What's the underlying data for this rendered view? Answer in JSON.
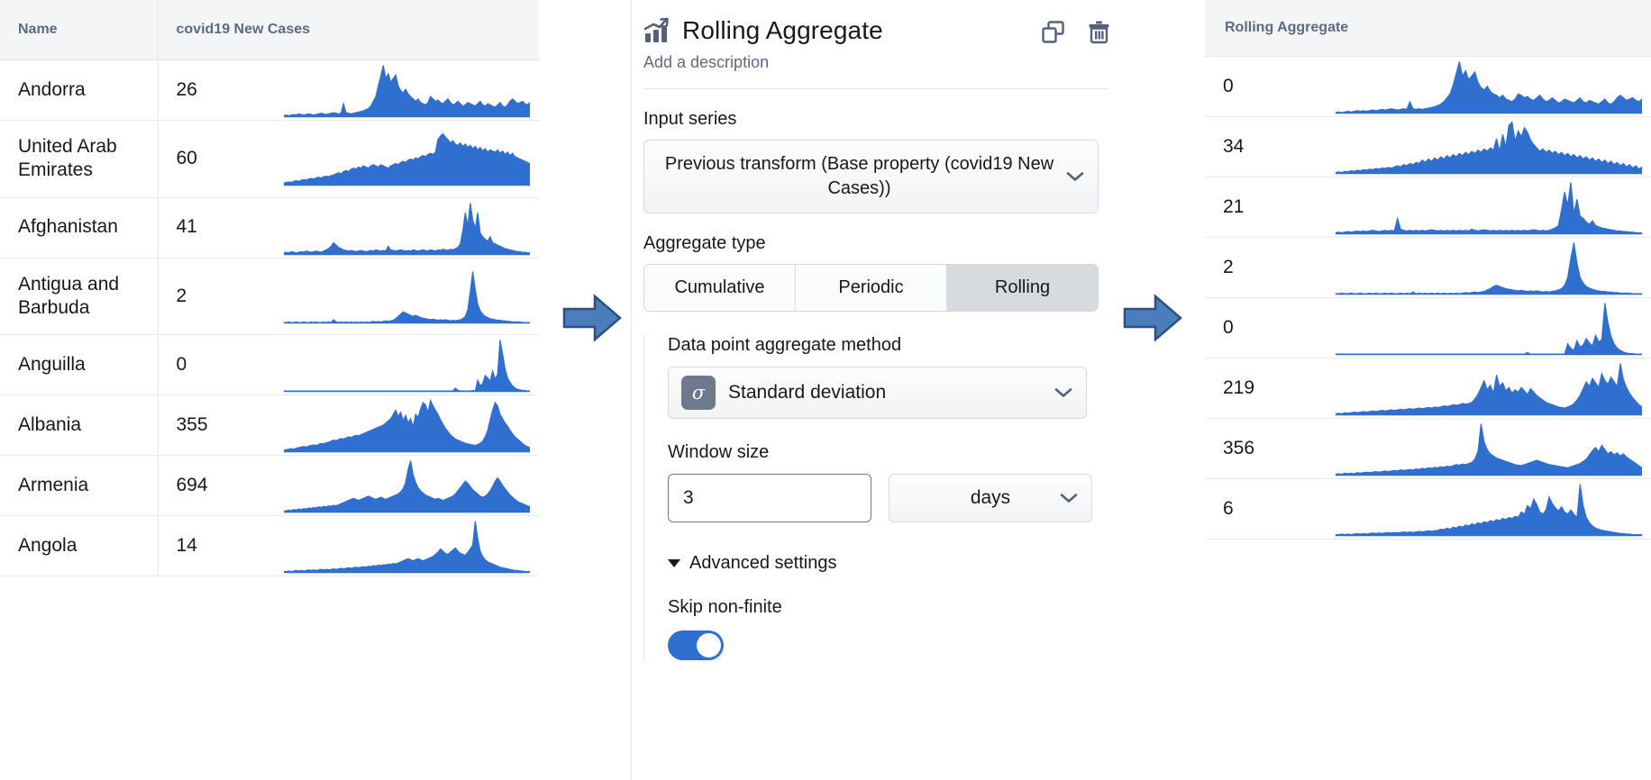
{
  "left_table": {
    "columns": [
      "Name",
      "covid19 New Cases",
      ""
    ],
    "rows": [
      {
        "name": "Andorra",
        "value": "26",
        "spark": "andorra-sparkline"
      },
      {
        "name": "United Arab Emirates",
        "value": "60",
        "spark": "uae-sparkline"
      },
      {
        "name": "Afghanistan",
        "value": "41",
        "spark": "afghanistan-sparkline"
      },
      {
        "name": "Antigua and Barbuda",
        "value": "2",
        "spark": "antigua-sparkline"
      },
      {
        "name": "Anguilla",
        "value": "0",
        "spark": "anguilla-sparkline"
      },
      {
        "name": "Albania",
        "value": "355",
        "spark": "albania-sparkline"
      },
      {
        "name": "Armenia",
        "value": "694",
        "spark": "armenia-sparkline"
      },
      {
        "name": "Angola",
        "value": "14",
        "spark": "angola-sparkline"
      }
    ]
  },
  "right_table": {
    "column": "Rolling Aggregate",
    "rows": [
      {
        "value": "0",
        "spark": "result-sparkline-1"
      },
      {
        "value": "34",
        "spark": "result-sparkline-2"
      },
      {
        "value": "21",
        "spark": "result-sparkline-3"
      },
      {
        "value": "2",
        "spark": "result-sparkline-4"
      },
      {
        "value": "0",
        "spark": "result-sparkline-5"
      },
      {
        "value": "219",
        "spark": "result-sparkline-6"
      },
      {
        "value": "356",
        "spark": "result-sparkline-7"
      },
      {
        "value": "6",
        "spark": "result-sparkline-8"
      }
    ]
  },
  "panel": {
    "icon": "chart-trending-up-icon",
    "title": "Rolling Aggregate",
    "description_placeholder": "Add a description",
    "actions": {
      "duplicate": "duplicate-icon",
      "delete": "trash-icon"
    },
    "input_series": {
      "label": "Input series",
      "value": "Previous transform (Base property (covid19 New Cases))"
    },
    "aggregate_type": {
      "label": "Aggregate type",
      "options": [
        "Cumulative",
        "Periodic",
        "Rolling"
      ],
      "selected": "Rolling"
    },
    "aggregate_method": {
      "label": "Data point aggregate method",
      "badge": "σ",
      "value": "Standard deviation"
    },
    "window_size": {
      "label": "Window size",
      "value": "3",
      "unit": "days"
    },
    "advanced": {
      "label": "Advanced settings",
      "expanded": true,
      "skip_non_finite_label": "Skip non-finite",
      "skip_non_finite_on": true
    }
  },
  "colors": {
    "sparkline": "#2f6fd0",
    "accent": "#2f6fd0",
    "arrow_fill": "#4a7ebb",
    "arrow_stroke": "#2d4f85",
    "header_bg": "#f4f5f7",
    "header_text": "#5d6b82",
    "icon": "#55617a"
  },
  "sparklines": {
    "andorra-sparkline": [
      2,
      3,
      2,
      3,
      4,
      3,
      5,
      4,
      3,
      4,
      5,
      4,
      3,
      4,
      5,
      6,
      5,
      4,
      5,
      6,
      7,
      6,
      5,
      6,
      22,
      7,
      6,
      5,
      6,
      7,
      8,
      9,
      10,
      12,
      14,
      18,
      26,
      34,
      52,
      68,
      86,
      64,
      72,
      58,
      64,
      70,
      52,
      44,
      40,
      46,
      38,
      34,
      30,
      26,
      30,
      24,
      22,
      20,
      24,
      34,
      30,
      26,
      28,
      24,
      22,
      26,
      30,
      24,
      20,
      22,
      26,
      22,
      18,
      20,
      24,
      22,
      20,
      18,
      22,
      26,
      20,
      18,
      22,
      20,
      18,
      16,
      20,
      24,
      18,
      16,
      20,
      26,
      30,
      26,
      22,
      24,
      26,
      22,
      20,
      24
    ],
    "uae-sparkline": [
      4,
      5,
      6,
      5,
      7,
      8,
      7,
      9,
      10,
      9,
      11,
      12,
      11,
      13,
      14,
      13,
      15,
      16,
      15,
      17,
      18,
      20,
      22,
      20,
      24,
      26,
      24,
      28,
      30,
      28,
      32,
      30,
      34,
      32,
      30,
      34,
      36,
      34,
      32,
      36,
      34,
      32,
      30,
      34,
      36,
      38,
      36,
      40,
      42,
      40,
      44,
      46,
      44,
      48,
      46,
      50,
      52,
      50,
      54,
      56,
      54,
      58,
      80,
      86,
      90,
      84,
      80,
      74,
      78,
      72,
      70,
      74,
      68,
      72,
      66,
      70,
      64,
      68,
      62,
      66,
      60,
      64,
      58,
      62,
      60,
      58,
      62,
      56,
      60,
      54,
      58,
      52,
      56,
      50,
      48,
      46,
      44,
      42,
      40,
      38
    ],
    "afghanistan-sparkline": [
      3,
      4,
      3,
      5,
      4,
      3,
      4,
      5,
      4,
      6,
      5,
      4,
      5,
      6,
      5,
      4,
      6,
      8,
      10,
      14,
      20,
      16,
      12,
      10,
      8,
      7,
      6,
      7,
      6,
      5,
      6,
      7,
      6,
      5,
      6,
      7,
      6,
      8,
      7,
      6,
      7,
      6,
      14,
      8,
      7,
      6,
      7,
      8,
      7,
      6,
      7,
      6,
      8,
      7,
      6,
      7,
      8,
      7,
      6,
      8,
      7,
      6,
      8,
      7,
      9,
      8,
      7,
      9,
      8,
      10,
      12,
      18,
      40,
      70,
      48,
      86,
      58,
      44,
      70,
      36,
      30,
      26,
      22,
      30,
      20,
      18,
      16,
      14,
      12,
      10,
      9,
      8,
      7,
      6,
      5,
      5,
      4,
      4,
      3,
      3
    ],
    "antigua-sparkline": [
      1,
      1,
      2,
      1,
      1,
      2,
      1,
      1,
      2,
      1,
      1,
      2,
      1,
      2,
      1,
      1,
      2,
      1,
      2,
      1,
      6,
      2,
      1,
      2,
      1,
      2,
      1,
      2,
      1,
      2,
      1,
      2,
      1,
      2,
      1,
      2,
      3,
      2,
      3,
      2,
      3,
      4,
      3,
      4,
      5,
      8,
      12,
      16,
      20,
      18,
      16,
      14,
      12,
      14,
      12,
      10,
      9,
      8,
      7,
      6,
      7,
      6,
      5,
      6,
      5,
      6,
      5,
      4,
      5,
      4,
      5,
      6,
      8,
      12,
      24,
      56,
      92,
      60,
      34,
      22,
      16,
      12,
      10,
      8,
      7,
      6,
      5,
      5,
      4,
      4,
      3,
      3,
      2,
      2,
      2,
      2,
      1,
      1,
      1,
      1
    ],
    "anguilla-sparkline": [
      1,
      1,
      1,
      1,
      1,
      1,
      1,
      1,
      1,
      1,
      1,
      1,
      1,
      1,
      1,
      1,
      1,
      1,
      1,
      1,
      1,
      1,
      1,
      1,
      1,
      1,
      1,
      1,
      1,
      1,
      1,
      1,
      1,
      1,
      1,
      1,
      1,
      1,
      1,
      1,
      1,
      1,
      1,
      1,
      1,
      1,
      1,
      1,
      1,
      1,
      1,
      1,
      1,
      1,
      1,
      1,
      1,
      1,
      1,
      1,
      1,
      1,
      1,
      1,
      1,
      1,
      1,
      1,
      1,
      6,
      2,
      1,
      1,
      1,
      1,
      1,
      2,
      1,
      20,
      10,
      14,
      28,
      24,
      18,
      36,
      22,
      30,
      90,
      66,
      40,
      24,
      16,
      10,
      6,
      4,
      3,
      2,
      2,
      1,
      1
    ],
    "albania-sparkline": [
      3,
      4,
      5,
      6,
      5,
      7,
      8,
      9,
      10,
      9,
      11,
      12,
      13,
      12,
      14,
      16,
      15,
      17,
      18,
      20,
      22,
      21,
      23,
      25,
      24,
      26,
      28,
      27,
      29,
      31,
      30,
      32,
      34,
      36,
      38,
      40,
      42,
      44,
      46,
      48,
      50,
      54,
      58,
      62,
      70,
      78,
      66,
      74,
      58,
      68,
      54,
      62,
      46,
      70,
      64,
      80,
      92,
      88,
      74,
      96,
      86,
      78,
      70,
      60,
      52,
      44,
      38,
      32,
      28,
      24,
      22,
      20,
      18,
      16,
      15,
      14,
      13,
      12,
      14,
      16,
      20,
      28,
      40,
      60,
      78,
      92,
      86,
      70,
      62,
      54,
      48,
      40,
      34,
      28,
      24,
      20,
      16,
      12,
      10,
      8
    ],
    "armenia-sparkline": [
      2,
      3,
      4,
      3,
      5,
      4,
      6,
      5,
      7,
      6,
      8,
      7,
      9,
      8,
      10,
      9,
      11,
      10,
      12,
      11,
      13,
      12,
      14,
      16,
      18,
      20,
      22,
      24,
      26,
      24,
      22,
      24,
      26,
      28,
      30,
      28,
      26,
      24,
      26,
      28,
      26,
      24,
      26,
      28,
      30,
      32,
      34,
      38,
      44,
      56,
      80,
      96,
      70,
      56,
      46,
      40,
      36,
      32,
      30,
      28,
      26,
      24,
      26,
      24,
      22,
      24,
      26,
      28,
      30,
      34,
      40,
      46,
      52,
      58,
      54,
      48,
      42,
      38,
      34,
      30,
      28,
      30,
      34,
      40,
      48,
      58,
      64,
      58,
      50,
      44,
      38,
      32,
      28,
      24,
      20,
      18,
      16,
      14,
      12,
      10
    ],
    "angola-sparkline": [
      2,
      2,
      3,
      2,
      3,
      4,
      3,
      4,
      3,
      4,
      5,
      4,
      5,
      4,
      5,
      6,
      5,
      6,
      5,
      6,
      7,
      6,
      7,
      8,
      7,
      8,
      9,
      8,
      9,
      10,
      9,
      10,
      11,
      10,
      12,
      11,
      13,
      12,
      14,
      13,
      15,
      14,
      16,
      15,
      17,
      16,
      18,
      20,
      22,
      24,
      26,
      24,
      22,
      24,
      26,
      24,
      22,
      24,
      26,
      28,
      30,
      34,
      38,
      44,
      40,
      36,
      34,
      38,
      42,
      46,
      40,
      36,
      34,
      32,
      38,
      44,
      52,
      96,
      64,
      40,
      30,
      24,
      20,
      18,
      16,
      14,
      12,
      10,
      9,
      8,
      7,
      6,
      5,
      4,
      4,
      3,
      3,
      2,
      2,
      2
    ],
    "result-sparkline-1": [
      1,
      2,
      1,
      2,
      3,
      2,
      3,
      4,
      3,
      4,
      3,
      4,
      5,
      4,
      5,
      6,
      5,
      6,
      7,
      6,
      5,
      6,
      7,
      6,
      18,
      7,
      6,
      7,
      6,
      7,
      8,
      9,
      10,
      12,
      14,
      18,
      24,
      30,
      44,
      62,
      80,
      58,
      66,
      52,
      58,
      64,
      48,
      40,
      36,
      42,
      34,
      30,
      28,
      24,
      28,
      22,
      20,
      18,
      22,
      30,
      28,
      24,
      26,
      22,
      20,
      24,
      28,
      22,
      18,
      20,
      24,
      20,
      16,
      18,
      22,
      20,
      18,
      16,
      20,
      24,
      18,
      16,
      20,
      18,
      16,
      14,
      18,
      22,
      16,
      14,
      18,
      24,
      28,
      24,
      20,
      22,
      24,
      20,
      18,
      22
    ],
    "result-sparkline-2": [
      2,
      3,
      2,
      4,
      3,
      5,
      4,
      6,
      5,
      7,
      6,
      8,
      7,
      9,
      8,
      10,
      9,
      11,
      10,
      12,
      14,
      12,
      16,
      14,
      18,
      16,
      20,
      18,
      24,
      20,
      26,
      22,
      28,
      24,
      30,
      26,
      32,
      28,
      34,
      30,
      36,
      32,
      38,
      34,
      40,
      36,
      42,
      38,
      44,
      40,
      46,
      42,
      62,
      40,
      70,
      48,
      86,
      92,
      58,
      76,
      66,
      82,
      74,
      60,
      52,
      46,
      40,
      44,
      38,
      42,
      36,
      40,
      34,
      38,
      32,
      36,
      30,
      34,
      28,
      32,
      26,
      30,
      24,
      28,
      22,
      26,
      20,
      24,
      18,
      22,
      16,
      20,
      14,
      18,
      12,
      16,
      10,
      14,
      8,
      12
    ],
    "result-sparkline-3": [
      2,
      3,
      2,
      3,
      4,
      3,
      4,
      5,
      4,
      5,
      4,
      5,
      6,
      5,
      4,
      5,
      6,
      5,
      6,
      5,
      26,
      8,
      6,
      5,
      6,
      5,
      6,
      5,
      6,
      5,
      6,
      7,
      6,
      5,
      6,
      5,
      6,
      5,
      6,
      5,
      6,
      5,
      6,
      5,
      8,
      6,
      5,
      6,
      7,
      6,
      5,
      6,
      5,
      6,
      5,
      6,
      5,
      6,
      5,
      6,
      5,
      6,
      5,
      6,
      7,
      6,
      5,
      6,
      5,
      6,
      8,
      10,
      14,
      40,
      70,
      48,
      86,
      34,
      58,
      30,
      26,
      20,
      16,
      22,
      14,
      12,
      10,
      9,
      8,
      7,
      6,
      5,
      5,
      4,
      4,
      3,
      3,
      2,
      2,
      2
    ],
    "result-sparkline-4": [
      1,
      1,
      2,
      1,
      1,
      2,
      1,
      1,
      2,
      1,
      1,
      2,
      1,
      2,
      1,
      1,
      2,
      1,
      2,
      1,
      1,
      2,
      1,
      2,
      1,
      4,
      1,
      2,
      1,
      2,
      1,
      2,
      1,
      2,
      1,
      2,
      1,
      2,
      1,
      2,
      1,
      2,
      3,
      2,
      3,
      4,
      3,
      4,
      5,
      8,
      10,
      14,
      16,
      14,
      12,
      10,
      9,
      8,
      7,
      6,
      7,
      6,
      5,
      6,
      5,
      6,
      5,
      4,
      5,
      4,
      5,
      6,
      8,
      10,
      16,
      30,
      64,
      92,
      56,
      30,
      20,
      14,
      11,
      9,
      7,
      6,
      5,
      5,
      4,
      4,
      3,
      3,
      2,
      2,
      2,
      2,
      1,
      1,
      1,
      1
    ],
    "result-sparkline-5": [
      1,
      1,
      1,
      1,
      1,
      1,
      1,
      1,
      1,
      1,
      1,
      1,
      1,
      1,
      1,
      1,
      1,
      1,
      1,
      1,
      1,
      1,
      1,
      1,
      1,
      1,
      1,
      1,
      1,
      1,
      1,
      1,
      1,
      1,
      1,
      1,
      1,
      1,
      1,
      1,
      1,
      1,
      1,
      1,
      1,
      1,
      1,
      1,
      1,
      1,
      1,
      1,
      1,
      1,
      1,
      1,
      1,
      1,
      1,
      1,
      1,
      1,
      4,
      1,
      1,
      1,
      1,
      1,
      1,
      1,
      1,
      1,
      1,
      1,
      1,
      20,
      12,
      8,
      26,
      14,
      18,
      30,
      22,
      16,
      36,
      24,
      28,
      96,
      60,
      34,
      20,
      12,
      8,
      5,
      3,
      2,
      2,
      1,
      1,
      1
    ],
    "result-sparkline-6": [
      2,
      3,
      2,
      4,
      3,
      4,
      5,
      4,
      5,
      6,
      5,
      6,
      7,
      6,
      7,
      8,
      7,
      8,
      9,
      8,
      9,
      10,
      9,
      10,
      11,
      10,
      11,
      12,
      11,
      12,
      13,
      12,
      14,
      13,
      14,
      16,
      15,
      16,
      18,
      17,
      18,
      20,
      19,
      20,
      22,
      28,
      36,
      48,
      60,
      44,
      52,
      38,
      70,
      50,
      56,
      42,
      48,
      38,
      44,
      40,
      48,
      42,
      36,
      46,
      40,
      34,
      30,
      26,
      22,
      20,
      18,
      16,
      14,
      13,
      12,
      14,
      16,
      20,
      26,
      34,
      46,
      58,
      50,
      64,
      56,
      48,
      72,
      60,
      54,
      66,
      58,
      50,
      90,
      62,
      48,
      38,
      30,
      24,
      18,
      14
    ],
    "result-sparkline-7": [
      2,
      3,
      2,
      4,
      3,
      4,
      3,
      5,
      4,
      5,
      6,
      5,
      6,
      7,
      6,
      7,
      8,
      7,
      8,
      9,
      8,
      10,
      9,
      10,
      11,
      10,
      12,
      11,
      13,
      12,
      14,
      13,
      15,
      14,
      16,
      15,
      17,
      16,
      18,
      20,
      19,
      21,
      20,
      22,
      24,
      30,
      44,
      96,
      62,
      48,
      40,
      36,
      32,
      30,
      28,
      26,
      24,
      22,
      20,
      19,
      18,
      20,
      22,
      24,
      26,
      28,
      26,
      24,
      22,
      20,
      19,
      18,
      17,
      16,
      15,
      14,
      16,
      18,
      20,
      22,
      26,
      30,
      38,
      46,
      52,
      44,
      56,
      48,
      40,
      44,
      38,
      42,
      36,
      40,
      34,
      30,
      26,
      22,
      18,
      14
    ],
    "result-sparkline-8": [
      2,
      2,
      3,
      2,
      3,
      2,
      3,
      4,
      3,
      4,
      3,
      4,
      5,
      4,
      5,
      4,
      5,
      6,
      5,
      6,
      5,
      6,
      7,
      6,
      7,
      6,
      7,
      8,
      7,
      8,
      9,
      8,
      9,
      10,
      12,
      11,
      14,
      12,
      16,
      14,
      18,
      16,
      20,
      18,
      22,
      20,
      24,
      22,
      26,
      24,
      28,
      26,
      30,
      28,
      32,
      30,
      34,
      32,
      36,
      34,
      44,
      40,
      56,
      50,
      68,
      58,
      44,
      40,
      48,
      72,
      60,
      52,
      46,
      54,
      44,
      40,
      48,
      40,
      34,
      96,
      56,
      34,
      24,
      18,
      14,
      12,
      10,
      9,
      8,
      7,
      6,
      5,
      4,
      4,
      3,
      3,
      2,
      2,
      2,
      2
    ]
  }
}
